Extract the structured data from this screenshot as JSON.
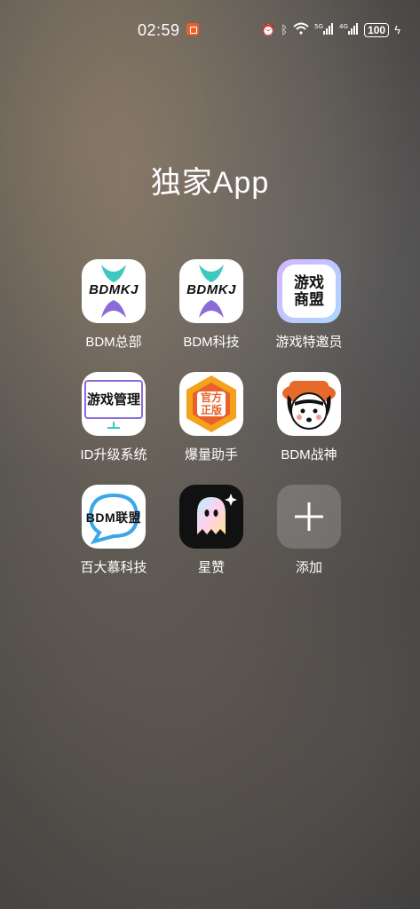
{
  "status": {
    "time": "02:59",
    "battery": "100"
  },
  "folder": {
    "title": "独家App"
  },
  "apps": [
    {
      "label": "BDM总部",
      "icon_text": "BDMKJ",
      "icon": "bdmkj-logo-icon"
    },
    {
      "label": "BDM科技",
      "icon_text": "BDMKJ",
      "icon": "bdmkj-logo-icon"
    },
    {
      "label": "游戏特邀员",
      "icon_text": "游戏商盟",
      "icon": "game-alliance-icon"
    },
    {
      "label": "ID升级系统",
      "icon_text": "游戏管理",
      "icon": "game-manage-icon"
    },
    {
      "label": "爆量助手",
      "icon_text": "官方正版",
      "icon": "official-badge-icon"
    },
    {
      "label": "BDM战神",
      "icon_text": "",
      "icon": "cartoon-face-icon"
    },
    {
      "label": "百大慕科技",
      "icon_text": "BDM联盟",
      "icon": "bdm-alliance-icon"
    },
    {
      "label": "星赞",
      "icon_text": "",
      "icon": "ghost-icon"
    },
    {
      "label": "添加",
      "icon_text": "",
      "icon": "plus-icon"
    }
  ],
  "colors": {
    "accent_orange": "#e8612c",
    "teal": "#3ec9c0",
    "purple": "#8a6bd8"
  }
}
